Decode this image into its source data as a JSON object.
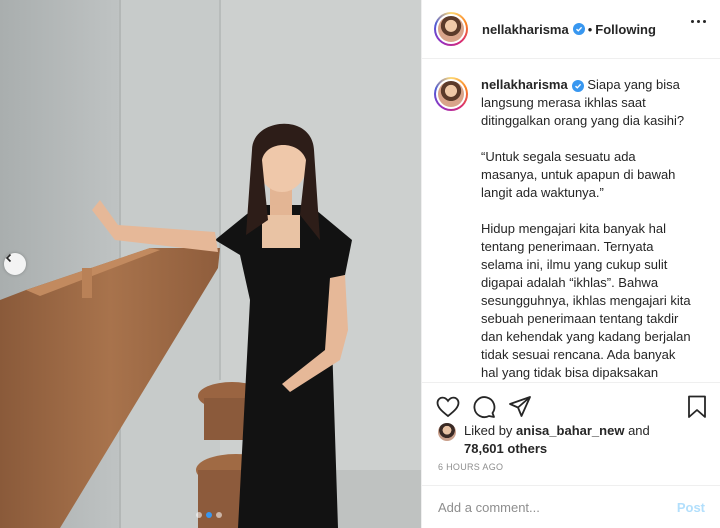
{
  "post": {
    "username": "nellakharisma",
    "follow_status": "Following",
    "separator": "•",
    "caption": "Siapa yang bisa langsung merasa ikhlas saat ditinggalkan orang yang dia kasihi?\n\n“Untuk segala sesuatu ada masanya, untuk apapun di bawah langit ada waktunya.”\n\nHidup mengajari kita banyak hal tentang penerimaan. Ternyata selama ini, ilmu yang cukup sulit digapai adalah “ikhlas”. Bahwa sesungguhnya, ikhlas mengajari kita sebuah penerimaan tentang takdir dan kehendak yang kadang berjalan tidak sesuai rencana. Ada banyak hal yang tidak bisa dipaksakan terlebih diusahakan jika memang takdir sudah menghendaki.",
    "likes": {
      "prefix": "Liked by",
      "liker": "anisa_bahar_new",
      "and": "and",
      "others": "78,601 others"
    },
    "timestamp": "6 HOURS AGO"
  },
  "comment": {
    "placeholder": "Add a comment...",
    "post_label": "Post"
  },
  "carousel": {
    "total": 3,
    "active_index": 1
  },
  "icons": {
    "more": "more-options-icon",
    "verified": "verified-badge-icon",
    "like": "heart-icon",
    "comment": "comment-icon",
    "share": "share-icon",
    "save": "bookmark-icon",
    "prev": "chevron-left-icon"
  },
  "colors": {
    "accent": "#3897f0",
    "text": "#262626",
    "muted": "#8e8e8e",
    "border": "#efefef",
    "post_disabled": "#b2dffc"
  }
}
